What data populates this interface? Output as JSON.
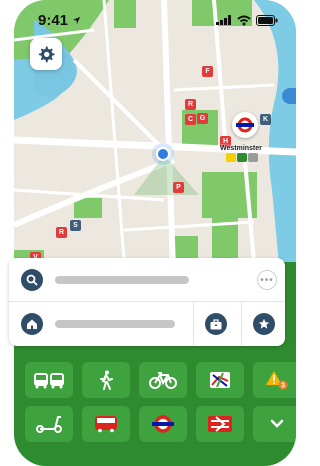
{
  "status_bar": {
    "time": "9:41",
    "location_arrow_icon": "location-arrow-icon",
    "signal_icon": "signal-icon",
    "wifi_icon": "wifi-icon",
    "battery_icon": "battery-icon"
  },
  "map": {
    "station_name": "Westminster",
    "poi_letters": [
      "F",
      "R",
      "C",
      "G",
      "H",
      "K",
      "P",
      "R",
      "S",
      "V"
    ],
    "line_colors": [
      "#f5d000",
      "#2e8b2f",
      "#9a9a9a"
    ]
  },
  "toolbar": {
    "settings_icon": "gear-icon"
  },
  "search_card": {
    "search_icon": "search-icon",
    "more_icon": "ellipsis-icon",
    "home_icon": "home-icon",
    "work_icon": "briefcase-icon",
    "favourites_icon": "star-icon"
  },
  "modes": [
    {
      "icon": "bus-train-icon"
    },
    {
      "icon": "walk-icon"
    },
    {
      "icon": "bicycle-icon"
    },
    {
      "icon": "map-icon"
    },
    {
      "icon": "alert-icon",
      "badge": "3"
    },
    {
      "icon": "scooter-icon"
    },
    {
      "icon": "bus-icon"
    },
    {
      "icon": "underground-roundel-icon"
    },
    {
      "icon": "national-rail-icon"
    },
    {
      "icon": "chevron-down-icon"
    }
  ],
  "colors": {
    "brand_green": "#2e8b2f",
    "tile_green": "#3ea33f",
    "navy": "#2f4d68",
    "tube_red": "#dc241f",
    "tube_blue": "#0019a8"
  }
}
